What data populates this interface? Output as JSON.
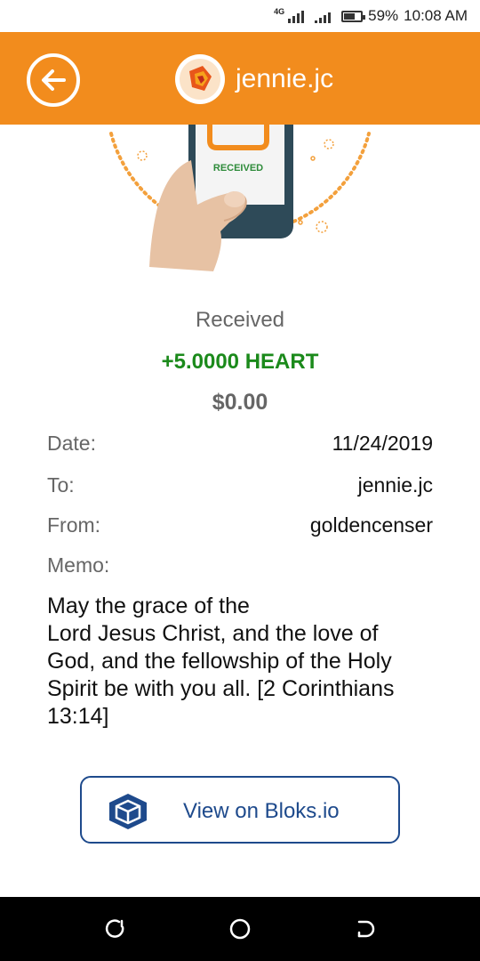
{
  "status_bar": {
    "network": "4G",
    "battery": "59%",
    "battery_level": 0.59,
    "time": "10:08 AM"
  },
  "app_bar": {
    "title": "jennie.jc",
    "back_icon": "back-arrow-circle-icon",
    "logo_icon": "heart-token-logo-icon"
  },
  "illustration": {
    "phone_label": "RECEIVED"
  },
  "transaction": {
    "status": "Received",
    "amount": "+5.0000 HEART",
    "usd_value": "$0.00",
    "colors": {
      "accent": "#f28c1d",
      "positive": "#1b8a1b",
      "link": "#1e4a8c"
    }
  },
  "details": {
    "date_label": "Date:",
    "date_value": "11/24/2019",
    "to_label": "To:",
    "to_value": "jennie.jc",
    "from_label": "From:",
    "from_value": "goldencenser",
    "memo_label": "Memo:",
    "memo_value": "May the grace of the\nLord Jesus Christ, and the love of\nGod, and the fellowship of the Holy\nSpirit be with you all. [2 Corinthians\n13:14]"
  },
  "bloks_button": {
    "label": "View on Bloks.io",
    "icon": "bloks-cube-icon"
  },
  "nav_bar": {
    "items": [
      "recent-apps-icon",
      "home-icon",
      "back-icon"
    ]
  }
}
